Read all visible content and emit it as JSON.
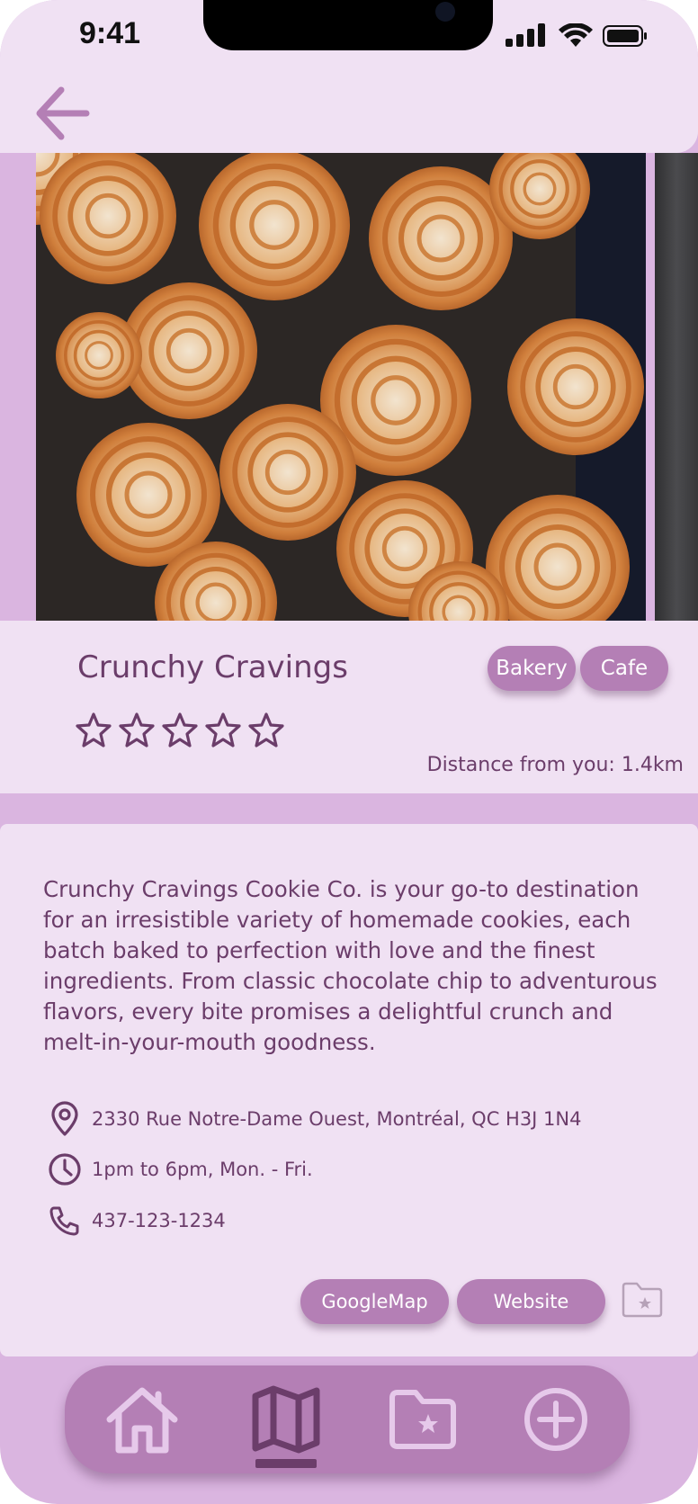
{
  "status_bar": {
    "time": "9:41"
  },
  "header": {
    "back_icon": "arrow-left-icon"
  },
  "place": {
    "name": "Crunchy Cravings",
    "tags": [
      "Bakery",
      "Cafe"
    ],
    "rating": {
      "filled": 0,
      "max": 5
    },
    "distance_text": "Distance from you: 1.4km",
    "description": "Crunchy Cravings Cookie Co. is your go-to destination for an irresistible variety of homemade cookies, each batch baked to perfection with love and the finest ingredients. From classic chocolate chip to adventurous flavors, every bite promises a delightful crunch and melt-in-your-mouth goodness.",
    "address": "2330 Rue Notre-Dame Ouest, Montréal, QC H3J 1N4",
    "hours": "1pm to 6pm, Mon. - Fri.",
    "phone": "437-123-1234"
  },
  "actions": {
    "googlemap_label": "GoogleMap",
    "website_label": "Website",
    "save_icon": "folder-star-icon"
  },
  "bottom_nav": {
    "items": [
      {
        "icon": "home-icon",
        "active": false
      },
      {
        "icon": "map-icon",
        "active": true
      },
      {
        "icon": "folder-star-icon",
        "active": false
      },
      {
        "icon": "plus-circle-icon",
        "active": false
      }
    ]
  },
  "colors": {
    "card_bg": "#f0e1f3",
    "page_bg": "#dab5e0",
    "accent": "#b47fb5",
    "text": "#6b3d6a"
  }
}
